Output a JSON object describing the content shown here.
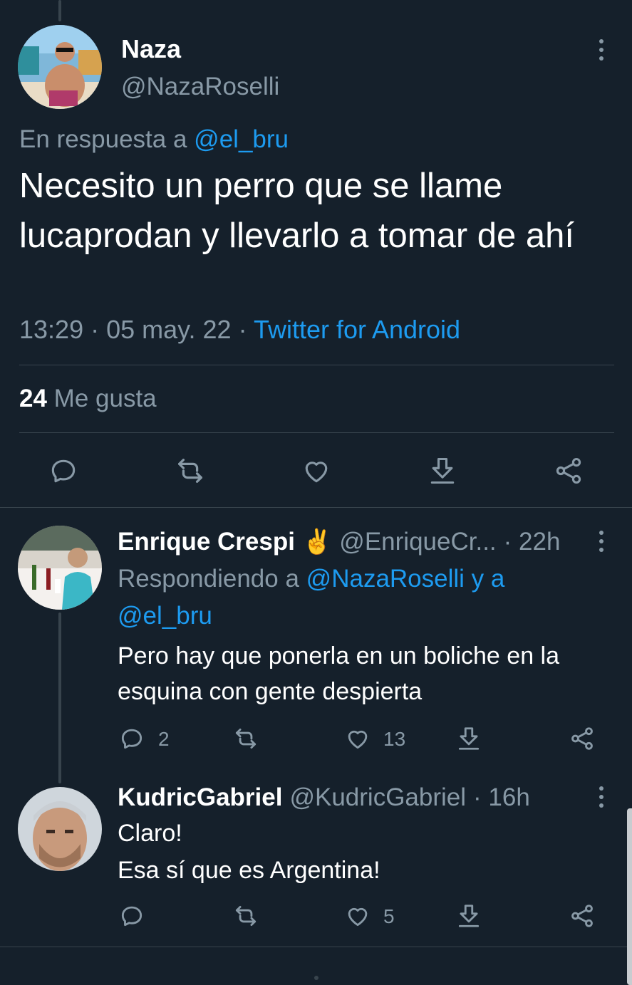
{
  "main_tweet": {
    "author_name": "Naza",
    "author_handle": "@NazaRoselli",
    "reply_prefix": "En respuesta a",
    "reply_to": "@el_bru",
    "text": "Necesito un perro que se llame lucaprodan y llevarlo a tomar de ahí",
    "time": "13:29",
    "date": "05 may. 22",
    "source": "Twitter for Android",
    "likes_count": "24",
    "likes_label": "Me gusta",
    "separator": "·"
  },
  "replies": [
    {
      "author_name": "Enrique Crespi",
      "emoji": "✌️",
      "author_handle": "@EnriqueCr...",
      "age": "· 22h",
      "replying_prefix": "Respondiendo a",
      "replying_to": "@NazaRoselli y a",
      "replying_to_2": "@el_bru",
      "text_line_1": "Pero hay que ponerla en un boliche en la",
      "text_line_2": "esquina con gente despierta",
      "reply_count": "2",
      "like_count": "13"
    },
    {
      "author_name": "KudricGabriel",
      "author_handle": "@KudricGabriel",
      "age": "· 16h",
      "text_line_1": "Claro!",
      "text_line_2": "Esa sí que es Argentina!",
      "like_count": "5"
    }
  ],
  "icons": {
    "reply": "reply-icon",
    "retweet": "retweet-icon",
    "like": "heart-icon",
    "download": "download-icon",
    "share": "share-icon",
    "more": "more-icon"
  },
  "colors": {
    "background": "#15202b",
    "link": "#1d9bf0",
    "muted": "#8899a6",
    "divider": "#38444d"
  }
}
